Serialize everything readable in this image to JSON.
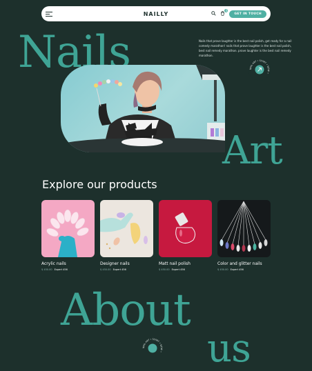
{
  "nav": {
    "logo": "NAILLY",
    "cta_label": "GET IN TOUCH",
    "cart_count": "0",
    "icons": [
      "menu-icon",
      "search-icon",
      "cart-icon"
    ]
  },
  "hero": {
    "word1": "Nails",
    "word2": "Art",
    "description": "Nails that prove laughter is the best nail polish, get ready for a nail comedy marathon! nails that prove laughter is the best nail polish, best nail remedy marathon. prove laughter is the best nail remedy marathon.",
    "badge_text": "NAIL ART • START • NOW •"
  },
  "products": {
    "title": "Explore our products",
    "items": [
      {
        "name": "Acrylic nails",
        "price": "$ 450.00",
        "tag": "Expert 456"
      },
      {
        "name": "Designer nails",
        "price": "$ 450.00",
        "tag": "Expert 456"
      },
      {
        "name": "Matt nail polish",
        "price": "$ 450.00",
        "tag": "Expert 456"
      },
      {
        "name": "Color and glitter nails",
        "price": "$ 450.00",
        "tag": "Expert 456"
      }
    ]
  },
  "about": {
    "word1": "About",
    "word2": "us"
  },
  "colors": {
    "background": "#1d302c",
    "accent": "#3fa495",
    "button": "#4fb0a3"
  }
}
